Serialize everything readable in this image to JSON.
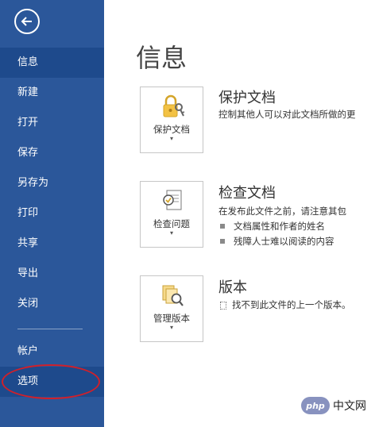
{
  "sidebar": {
    "back_icon": "back-arrow-icon",
    "items": [
      {
        "label": "信息",
        "active": true
      },
      {
        "label": "新建"
      },
      {
        "label": "打开"
      },
      {
        "label": "保存"
      },
      {
        "label": "另存为"
      },
      {
        "label": "打印"
      },
      {
        "label": "共享"
      },
      {
        "label": "导出"
      },
      {
        "label": "关闭"
      }
    ],
    "bottom_items": [
      {
        "label": "帐户"
      },
      {
        "label": "选项",
        "highlighted": true
      }
    ],
    "color": "#2b579a"
  },
  "main": {
    "title": "信息",
    "sections": [
      {
        "button_label": "保护文档",
        "icon": "lock-key-icon",
        "title": "保护文档",
        "description": "控制其他人可以对此文档所做的更"
      },
      {
        "button_label": "检查问题",
        "icon": "inspect-document-icon",
        "title": "检查文档",
        "description": "在发布此文件之前，请注意其包",
        "bullets": [
          "文档属性和作者的姓名",
          "残障人士难以阅读的内容"
        ]
      },
      {
        "button_label": "管理版本",
        "icon": "manage-versions-icon",
        "title": "版本",
        "note": "找不到此文件的上一个版本。"
      }
    ]
  },
  "watermark": {
    "badge": "php",
    "text": "中文网"
  }
}
